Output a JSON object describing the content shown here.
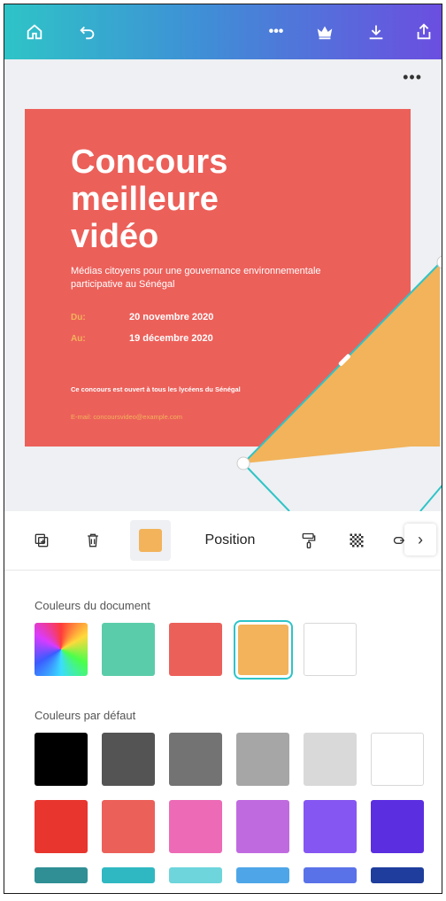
{
  "topbar": {
    "icons": [
      "home-icon",
      "undo-icon",
      "more-icon",
      "crown-icon",
      "download-icon",
      "share-icon"
    ],
    "more_label": "•••"
  },
  "canvas": {
    "more_label": "•••",
    "design": {
      "title_lines": [
        "Concours",
        "meilleure",
        "vidéo"
      ],
      "subtitle": "Médias citoyens pour une gouvernance environnementale participative au Sénégal",
      "dates": [
        {
          "label": "Du:",
          "value": "20 novembre 2020"
        },
        {
          "label": "Au:",
          "value": "19 décembre 2020"
        }
      ],
      "note": "Ce concours est ouvert à tous les lycéens du Sénégal",
      "email": "E-mail: concoursvideo@example.com",
      "background_color": "#ec605a",
      "shape_color": "#f2b35b"
    }
  },
  "toolbar": {
    "position_label": "Position",
    "chevron": "›",
    "icons": [
      "duplicate-icon",
      "trash-icon",
      "color-picker",
      "paint-roller-icon",
      "transparency-icon",
      "link-icon"
    ]
  },
  "palette": {
    "document_title": "Couleurs du document",
    "document_colors": [
      "rainbow",
      "#5bcca9",
      "#ec605a",
      "#f2b35b",
      "#ffffff"
    ],
    "selected_color": "#f2b35b",
    "default_title": "Couleurs par défaut",
    "default_rows": [
      [
        "#000000",
        "#545454",
        "#737373",
        "#a6a6a6",
        "#d9d9d9",
        "#ffffff"
      ],
      [
        "#e8352e",
        "#ec605a",
        "#ec6ab6",
        "#c06ae0",
        "#8656f2",
        "#5b2ee0"
      ],
      [
        "#2f8f94",
        "#30b8c2",
        "#6dd5db",
        "#4ea6e8",
        "#5a72e8",
        "#1e3d9c"
      ]
    ]
  }
}
